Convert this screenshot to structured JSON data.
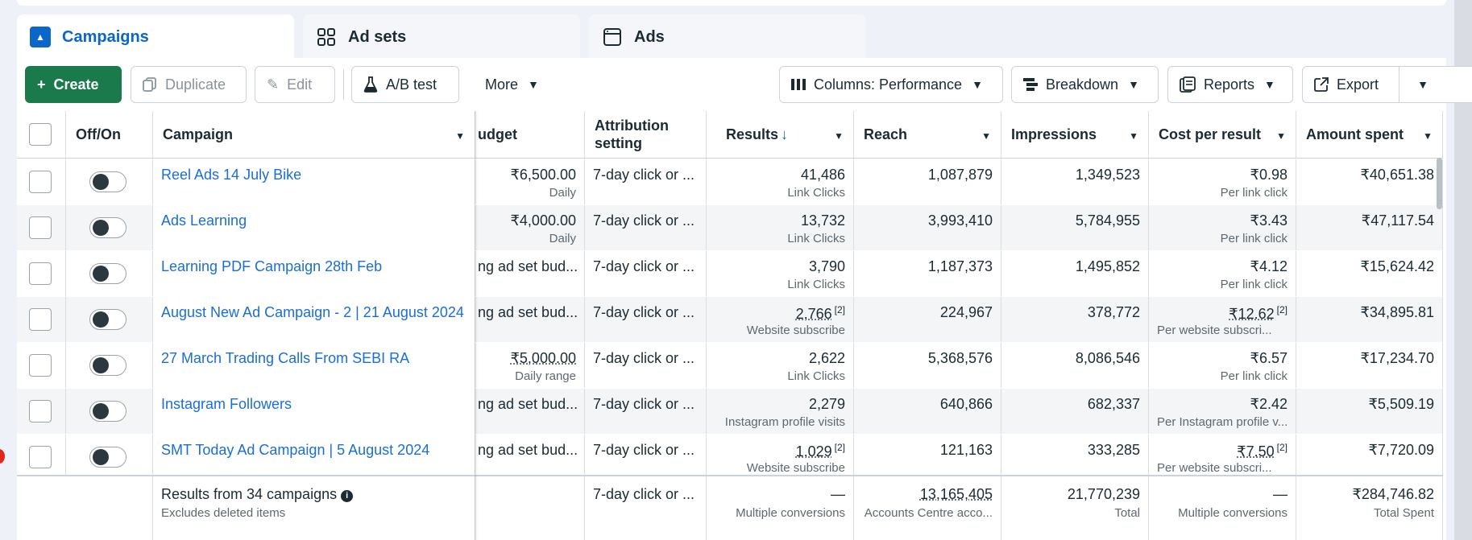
{
  "tabs": [
    {
      "label": "Campaigns",
      "icon": "campaign-folder-icon",
      "active": true
    },
    {
      "label": "Ad sets",
      "icon": "grid-icon",
      "active": false
    },
    {
      "label": "Ads",
      "icon": "ad-window-icon",
      "active": false
    }
  ],
  "toolbar": {
    "create": "Create",
    "duplicate": "Duplicate",
    "edit": "Edit",
    "ab_test": "A/B test",
    "more": "More",
    "columns": "Columns: Performance",
    "breakdown": "Breakdown",
    "reports": "Reports",
    "export": "Export"
  },
  "columns": {
    "off_on": "Off/On",
    "campaign": "Campaign",
    "budget": "udget",
    "attribution": "Attribution setting",
    "results": "Results",
    "reach": "Reach",
    "impressions": "Impressions",
    "cost_per_result": "Cost per result",
    "amount_spent": "Amount spent"
  },
  "rows": [
    {
      "name": "Reel Ads 14 July Bike",
      "budget": "₹6,500.00",
      "budget_sub": "Daily",
      "attribution": "7-day click or ...",
      "results": "41,486",
      "results_sub": "Link Clicks",
      "reach": "1,087,879",
      "impressions": "1,349,523",
      "cpr": "₹0.98",
      "cpr_sub": "Per link click",
      "spent": "₹40,651.38"
    },
    {
      "name": "Ads Learning",
      "budget": "₹4,000.00",
      "budget_sub": "Daily",
      "attribution": "7-day click or ...",
      "results": "13,732",
      "results_sub": "Link Clicks",
      "reach": "3,993,410",
      "impressions": "5,784,955",
      "cpr": "₹3.43",
      "cpr_sub": "Per link click",
      "spent": "₹47,117.54"
    },
    {
      "name": "Learning PDF Campaign 28th Feb",
      "budget": "ng ad set bud...",
      "budget_sub": "",
      "attribution": "7-day click or ...",
      "results": "3,790",
      "results_sub": "Link Clicks",
      "reach": "1,187,373",
      "impressions": "1,495,852",
      "cpr": "₹4.12",
      "cpr_sub": "Per link click",
      "spent": "₹15,624.42"
    },
    {
      "name": "August New Ad Campaign - 2 | 21 August 2024",
      "budget": "ng ad set bud...",
      "budget_sub": "",
      "attribution": "7-day click or ...",
      "results": "2,766",
      "results_ref": "[2]",
      "results_sub": "Website subscribe",
      "reach": "224,967",
      "impressions": "378,772",
      "cpr": "₹12.62",
      "cpr_ref": "[2]",
      "cpr_sub": "Per website subscri...",
      "spent": "₹34,895.81"
    },
    {
      "name": "27 March Trading Calls From SEBI RA",
      "budget": "₹5,000.00",
      "budget_sub": "Daily range",
      "attribution": "7-day click or ...",
      "results": "2,622",
      "results_sub": "Link Clicks",
      "reach": "5,368,576",
      "impressions": "8,086,546",
      "cpr": "₹6.57",
      "cpr_sub": "Per link click",
      "spent": "₹17,234.70"
    },
    {
      "name": "Instagram Followers",
      "budget": "ng ad set bud...",
      "budget_sub": "",
      "attribution": "7-day click or ...",
      "results": "2,279",
      "results_sub": "Instagram profile visits",
      "reach": "640,866",
      "impressions": "682,337",
      "cpr": "₹2.42",
      "cpr_sub": "Per Instagram profile v...",
      "spent": "₹5,509.19"
    },
    {
      "name": "SMT Today Ad Campaign | 5 August 2024",
      "budget": "ng ad set bud...",
      "budget_sub": "",
      "attribution": "7-day click or ...",
      "results": "1,029",
      "results_ref": "[2]",
      "results_sub": "Website subscribe",
      "reach": "121,163",
      "impressions": "333,285",
      "cpr": "₹7.50",
      "cpr_ref": "[2]",
      "cpr_sub": "Per website subscri...",
      "spent": "₹7,720.09"
    }
  ],
  "footer": {
    "title": "Results from 34 campaigns",
    "subtitle": "Excludes deleted items",
    "attribution": "7-day click or ...",
    "results": "—",
    "results_sub": "Multiple conversions",
    "reach": "13,165,405",
    "reach_sub": "Accounts Centre acco...",
    "impressions": "21,770,239",
    "impressions_sub": "Total",
    "cpr": "—",
    "cpr_sub": "Multiple conversions",
    "spent": "₹284,746.82",
    "spent_sub": "Total Spent"
  },
  "colors": {
    "accent": "#0a66c8",
    "create": "#1a7a4c",
    "link": "#1a6ed8"
  }
}
